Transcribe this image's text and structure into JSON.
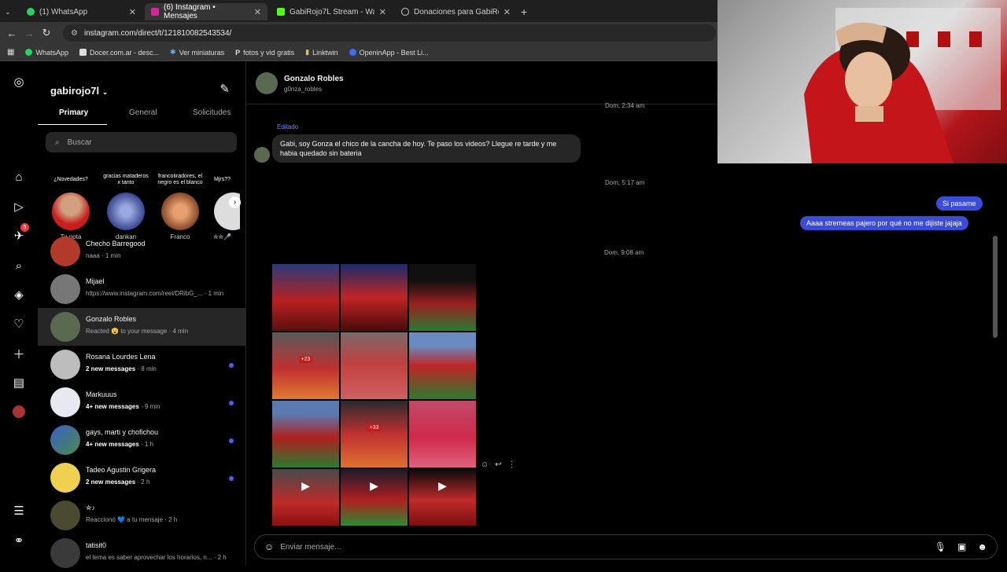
{
  "browser": {
    "tabs": [
      {
        "label": "(1) WhatsApp",
        "color": "#25d366"
      },
      {
        "label": "(6) Instagram • Mensajes",
        "color": "#d6249f"
      },
      {
        "label": "GabiRojo7L Stream - Watch Liv",
        "color": "#53fc18"
      },
      {
        "label": "Donaciones para GabiRojo7l | C",
        "color": "#cccccc"
      }
    ],
    "url": "instagram.com/direct/t/121810082543534/",
    "bookmarks": [
      "WhatsApp",
      "Docer.com.ar - desc...",
      "Ver miniaturas",
      "fotos y vid gratis",
      "Linktwin",
      "OpeninApp - Best Li..."
    ]
  },
  "inbox": {
    "username": "gabirojo7l",
    "tabs": [
      "Primary",
      "General",
      "Solicitudes"
    ],
    "search_placeholder": "Buscar",
    "notes": [
      {
        "bubble": "¿Novedades?",
        "name": "Tu nota"
      },
      {
        "bubble": "gracias mataderos x tanto",
        "name": "dankan"
      },
      {
        "bubble": "francotiradores, el negro es el blanco",
        "name": "Franco"
      },
      {
        "bubble": "Mjrs??",
        "name": "✮✮🎤"
      }
    ],
    "conversations": [
      {
        "name": "Checho Barregood",
        "sub": "naaa · 1 min",
        "unread": false
      },
      {
        "name": "Mijael",
        "sub": "https://www.instagram.com/reel/DRibG_... · 1 min",
        "unread": false
      },
      {
        "name": "Gonzalo Robles",
        "sub": "Reacted 😮 to your message · 4 min",
        "unread": false
      },
      {
        "name": "Rosana Lourdes Lena",
        "sub_bold": "2 new messages",
        "sub": " · 8 min",
        "unread": true
      },
      {
        "name": "Markuuus",
        "sub_bold": "4+ new messages",
        "sub": " · 9 min",
        "unread": true
      },
      {
        "name": "gays, marti y chofichou",
        "sub_bold": "4+ new messages",
        "sub": " · 1 h",
        "unread": true
      },
      {
        "name": "Tadeo Agustin Grigera",
        "sub_bold": "2 new messages",
        "sub": " · 2 h",
        "unread": true
      },
      {
        "name": "✮♪",
        "sub": "Reaccionó 💙 a tu mensaje · 2 h",
        "unread": false
      },
      {
        "name": "tatisit0",
        "sub": "el tema es saber aprovechar los horarios, n... · 2 h",
        "unread": false
      }
    ]
  },
  "chat": {
    "name": "Gonzalo Robles",
    "handle": "g0nza_robles",
    "timestamps": [
      "Dom, 2:34 am",
      "Dom, 5:17 am",
      "Dom, 9:08 am"
    ],
    "edited_label": "Editado",
    "incoming_message": "Gabi, soy Gonza el chico de la cancha de hoy. Te paso los videos? Llegue re tarde y me habia quedado sin bateria",
    "outgoing_messages": [
      "Si pasame",
      "Aaaa stremeas pajero por qué no me dijiste jajaja"
    ],
    "photo_badges": {
      "tile_4": "+23",
      "tile_8": "+33"
    },
    "composer_placeholder": "Enviar mensaje...",
    "notification_count": "5"
  }
}
